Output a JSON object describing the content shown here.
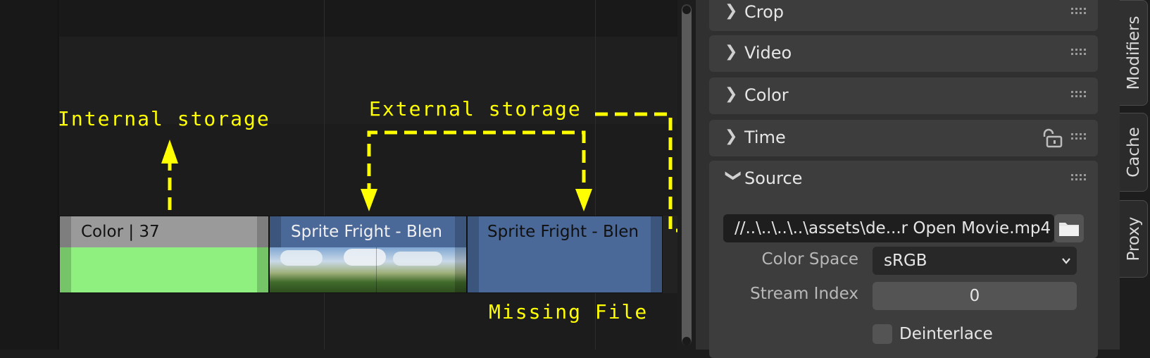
{
  "timeline": {
    "strips": [
      {
        "label": "Color | 37",
        "type": "color"
      },
      {
        "label": "Sprite Fright - Blen",
        "type": "movie"
      },
      {
        "label": "Sprite Fright - Blen",
        "type": "movie-missing"
      }
    ],
    "annotations": {
      "internal": "Internal storage",
      "external": "External storage",
      "missing": "Missing File"
    },
    "annotation_color": "#ffff00"
  },
  "properties": {
    "sections": [
      {
        "title": "Crop",
        "expanded": false
      },
      {
        "title": "Video",
        "expanded": false
      },
      {
        "title": "Color",
        "expanded": false
      },
      {
        "title": "Time",
        "expanded": false
      },
      {
        "title": "Source",
        "expanded": true
      }
    ],
    "source": {
      "filepath": "//..\\..\\..\\..\\assets\\de...r Open Movie.mp4",
      "color_space_label": "Color Space",
      "color_space_value": "sRGB",
      "stream_index_label": "Stream Index",
      "stream_index_value": "0",
      "deinterlace_label": "Deinterlace",
      "deinterlace_checked": false
    }
  },
  "tabs": [
    "Modifiers",
    "Cache",
    "Proxy"
  ],
  "colors": {
    "color_strip": "#8fef7f",
    "movie_strip": "#4a6898",
    "background": "#1d1d1d",
    "panel": "#303030"
  }
}
